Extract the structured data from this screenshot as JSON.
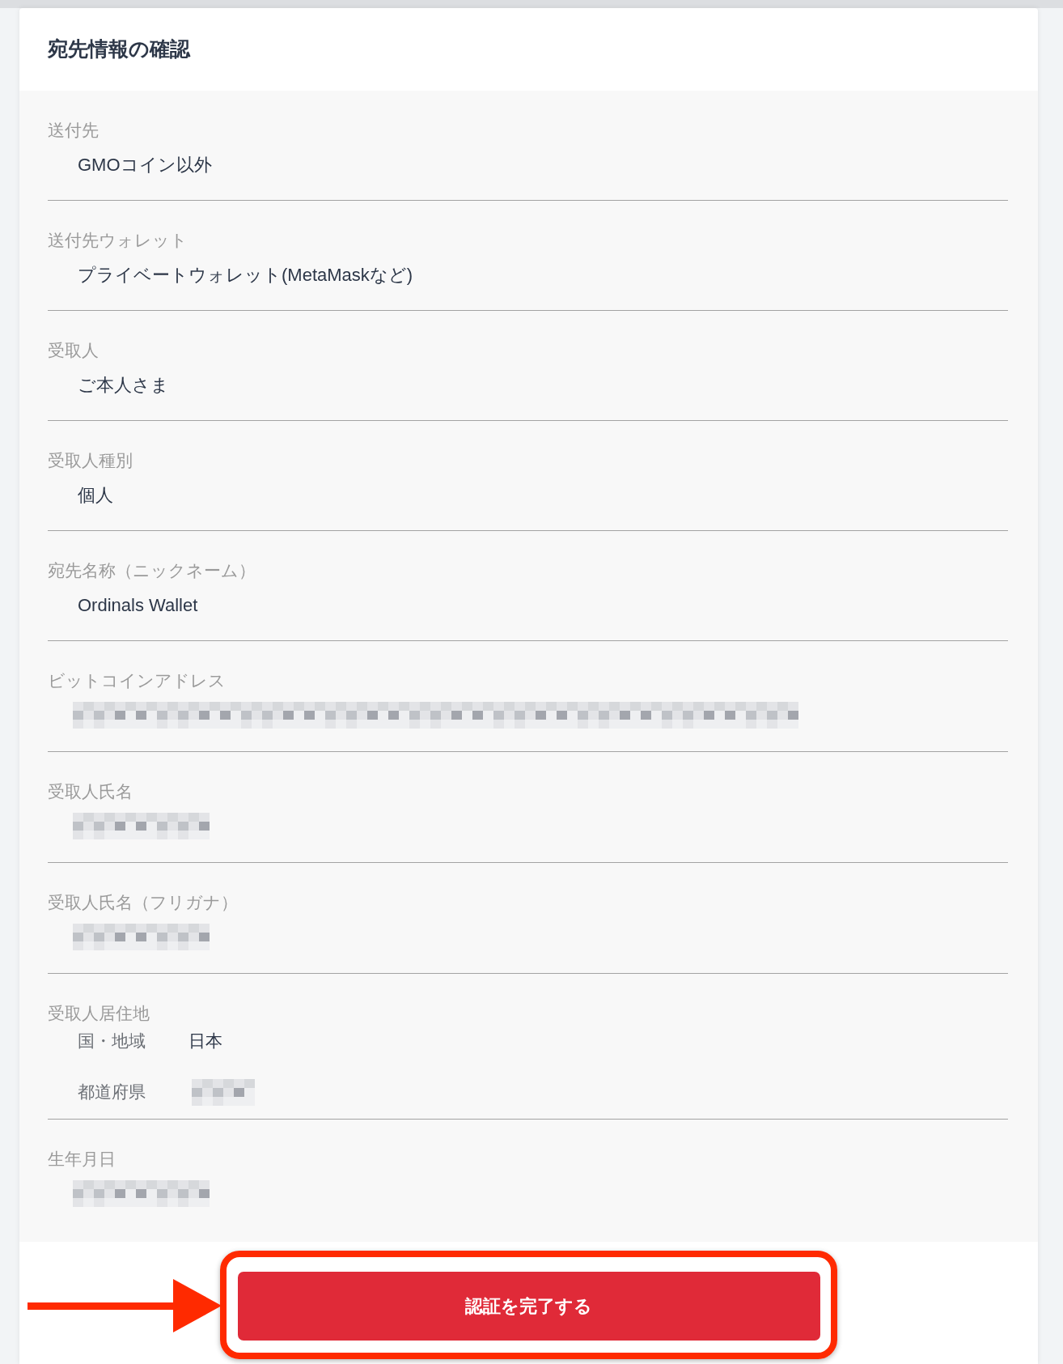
{
  "panel": {
    "title": "宛先情報の確認"
  },
  "fields": [
    {
      "kind": "text",
      "label": "送付先",
      "value": "GMOコイン以外"
    },
    {
      "kind": "text",
      "label": "送付先ウォレット",
      "value": "プライベートウォレット(MetaMaskなど)"
    },
    {
      "kind": "text",
      "label": "受取人",
      "value": "ご本人さま"
    },
    {
      "kind": "text",
      "label": "受取人種別",
      "value": "個人"
    },
    {
      "kind": "text",
      "label": "宛先名称（ニックネーム）",
      "value": "Ordinals Wallet"
    },
    {
      "kind": "maskedwide",
      "label": "ビットコインアドレス"
    },
    {
      "kind": "masked",
      "label": "受取人氏名"
    },
    {
      "kind": "masked",
      "label": "受取人氏名（フリガナ）"
    },
    {
      "kind": "group",
      "label": "受取人居住地",
      "items": [
        {
          "kind": "text",
          "label": "国・地域",
          "value": "日本"
        },
        {
          "kind": "maskedshort",
          "label": "都道府県"
        }
      ]
    },
    {
      "kind": "masked",
      "label": "生年月日"
    }
  ],
  "submit_button": {
    "label": "認証を完了する"
  },
  "annotation": {
    "highlight": true,
    "arrow": true
  }
}
